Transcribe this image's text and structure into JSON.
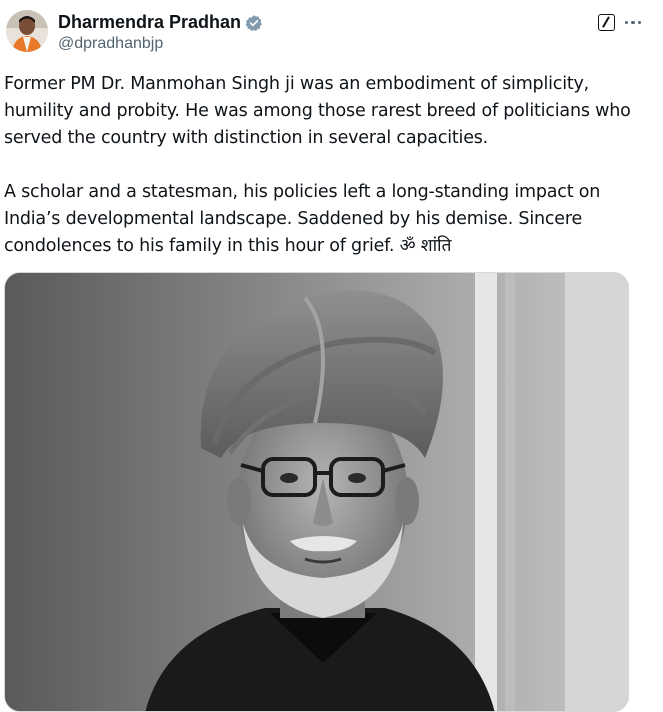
{
  "author": {
    "display_name": "Dharmendra Pradhan",
    "handle": "@dpradhanbjp",
    "verified": true,
    "avatar_icon": "profile-photo"
  },
  "actions": {
    "grok_icon": "grok-icon",
    "more_icon": "more-options-icon"
  },
  "tweet": {
    "paragraph1": "Former PM Dr. Manmohan Singh ji was an embodiment of simplicity, humility and probity. He was among those rarest breed of politicians who served the country with distinction in several capacities.",
    "paragraph2": "A scholar and a statesman, his policies left a long-standing impact on India’s developmental landscape. Saddened by his demise. Sincere condolences to his family in this hour of grief. ॐ शांति"
  },
  "media": {
    "type": "photo",
    "style": "black-and-white portrait"
  },
  "colors": {
    "text_primary": "#0f1419",
    "text_secondary": "#536471",
    "verified_badge": "#829aab",
    "border": "#cfd9de"
  }
}
